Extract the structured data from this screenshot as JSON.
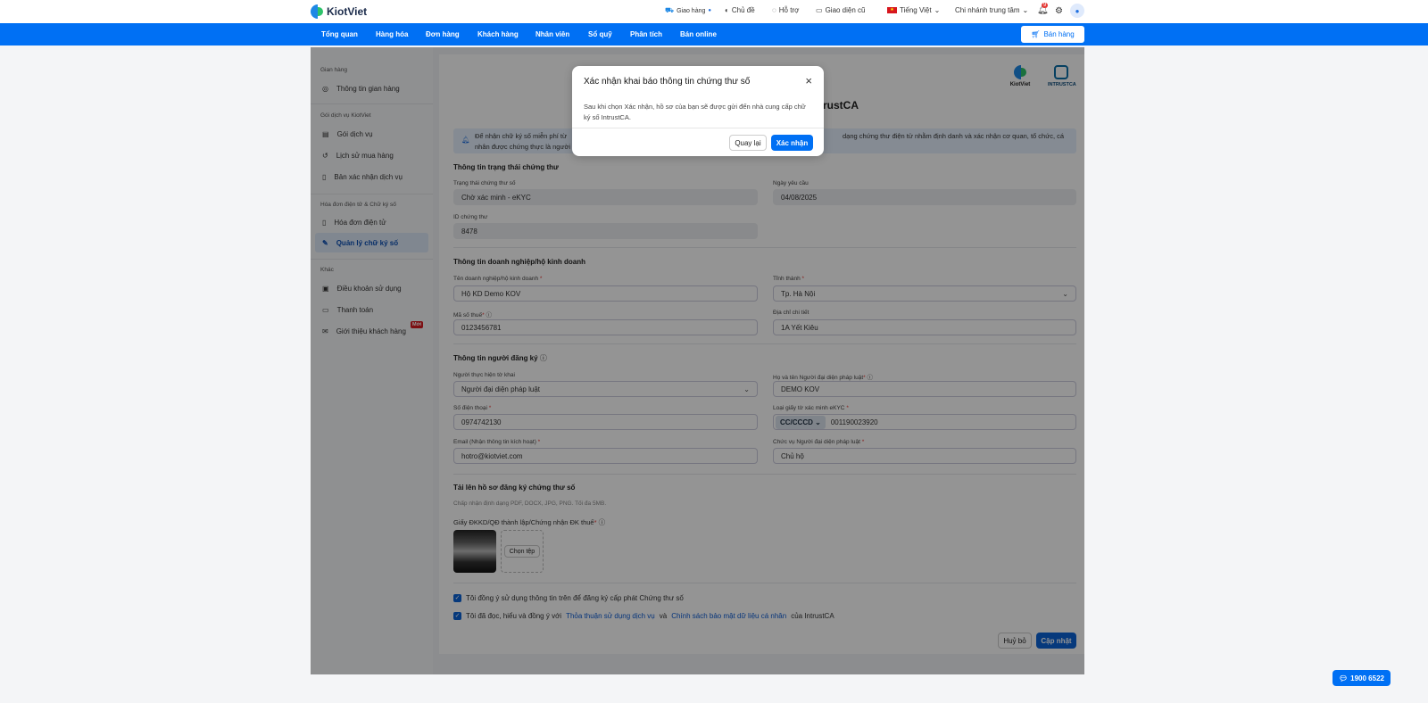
{
  "header": {
    "brand": "KiotViet",
    "shipping": "Giao hàng",
    "theme": "Chủ đề",
    "support": "Hỗ trợ",
    "old_ui": "Giao diện cũ",
    "language": "Tiếng Việt",
    "branch": "Chi nhánh trung tâm",
    "notif_count": "9"
  },
  "nav": {
    "items": [
      "Tổng quan",
      "Hàng hóa",
      "Đơn hàng",
      "Khách hàng",
      "Nhân viên",
      "Sổ quỹ",
      "Phân tích",
      "Bán online"
    ],
    "sell": "Bán hàng"
  },
  "sidebar": {
    "groups": [
      "Gian hàng",
      "Gói dịch vụ KiotViet",
      "Hóa đơn điện tử & Chữ ký số",
      "Khác"
    ],
    "items": [
      "Thông tin gian hàng",
      "Gói dịch vụ",
      "Lịch sử mua hàng",
      "Bản xác nhận dịch vụ",
      "Hóa đơn điện tử",
      "Quản lý chữ ký số",
      "Điều khoản sử dụng",
      "Thanh toán",
      "Giới thiệu khách hàng"
    ],
    "new_badge": "Mới"
  },
  "page": {
    "title_fragment": "rustCA",
    "logo_kv": "KiotViet",
    "logo_ica": "INTRUSTCA",
    "banner_l1a": "Để nhận chữ ký số miễn phí từ",
    "banner_l1b": "dạng chứng thư điện tử nhằm định danh và xác nhận cơ quan, tổ chức, cá",
    "banner_l2a": "nhân được chứng thực là người",
    "s1": "Thông tin trạng thái chứng thư",
    "status_label": "Trạng thái chứng thư số",
    "status": "Chờ xác minh - eKYC",
    "date_label": "Ngày yêu cầu",
    "date": "04/08/2025",
    "id_label": "ID chứng thư",
    "id": "8478",
    "s2": "Thông tin doanh nghiệp/hộ kinh doanh",
    "biz_label": "Tên doanh nghiệp/hộ kinh doanh",
    "biz": "Hộ KD Demo KOV",
    "prov_label": "Tỉnh thành",
    "prov": "Tp. Hà Nội",
    "tax_label": "Mã số thuế",
    "tax": "0123456781",
    "addr_label": "Địa chỉ chi tiết",
    "addr": "1A Yết Kiêu",
    "s3": "Thông tin người đăng ký",
    "decl_label": "Người thực hiện tờ khai",
    "decl": "Người đại diện pháp luật",
    "rep_label": "Họ và tên Người đại diện pháp luật",
    "rep": "DEMO KOV",
    "phone_label": "Số điện thoại",
    "phone": "0974742130",
    "doc_label": "Loại giấy tờ xác minh eKYC",
    "doc_type": "CC/CCCD",
    "doc_no": "001190023920",
    "email_label": "Email (Nhận thông tin kích hoạt)",
    "email": "hotro@kiotviet.com",
    "pos_label": "Chức vụ Người đại diện pháp luật",
    "pos": "Chủ hộ",
    "s4": "Tải lên hồ sơ đăng ký chứng thư số",
    "accept": "Chấp nhận định dạng PDF, DOCX, JPG, PNG. Tối đa 5MB.",
    "file_label": "Giấy ĐKKD/QĐ thành lập/Chứng nhận ĐK thuế",
    "choose": "Chọn tệp",
    "agree1": "Tôi đồng ý sử dụng thông tin trên để đăng ký cấp phát Chứng thư số",
    "agree2a": "Tôi đã đọc, hiểu và đồng ý với",
    "agree2_link1": "Thỏa thuận sử dụng dịch vụ",
    "agree2_and": "và",
    "agree2_link2": "Chính sách bảo mật dữ liệu cá nhân",
    "agree2_end": "của IntrustCA",
    "cancel": "Huỷ bỏ",
    "update": "Cập nhật"
  },
  "modal": {
    "title": "Xác nhận khai báo thông tin chứng thư số",
    "body": "Sau khi chọn Xác nhận, hồ sơ của bạn sẽ được gửi đến nhà cung cấp chữ ký số IntrustCA.",
    "back": "Quay lại",
    "confirm": "Xác nhận"
  },
  "hotline": "1900 6522"
}
